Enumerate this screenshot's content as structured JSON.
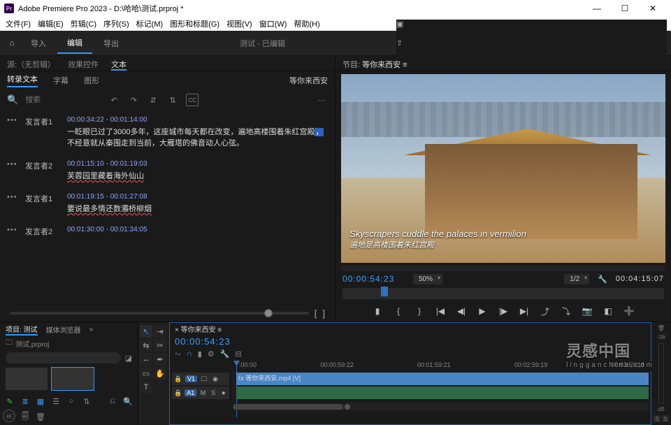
{
  "title": "Adobe Premiere Pro 2023 - D:\\哈哈\\测试.prproj *",
  "menu": [
    "文件(F)",
    "编辑(E)",
    "剪辑(C)",
    "序列(S)",
    "标记(M)",
    "图形和标题(G)",
    "视图(V)",
    "窗口(W)",
    "帮助(H)"
  ],
  "workspace": {
    "tabs": [
      "导入",
      "编辑",
      "导出"
    ],
    "active": "编辑",
    "status": "测试 - 已编辑"
  },
  "source_panel": {
    "tabs": [
      "源:（无剪辑）",
      "效果控件",
      "文本"
    ],
    "active": "文本",
    "sub_tabs": [
      "转录文本",
      "字幕",
      "图形"
    ],
    "sub_active": "转录文本",
    "context_label": "等你来西安",
    "search_placeholder": "搜索",
    "rows": [
      {
        "speaker": "发言者1",
        "tc": "00:00:34:22 - 00:01:14:00",
        "text_pre": "一眨眼已过了3000多年，这座城市每天都在改变，遍地高楼围着朱红宫殿",
        "hl": "，",
        "text_post": "不经意就从秦围走到当前，大雁塔的佛音动人心弦。"
      },
      {
        "speaker": "发言者2",
        "tc": "00:01:15:10 - 00:01:19:03",
        "underlined": "芙蓉园里藏着海外仙山"
      },
      {
        "speaker": "发言者1",
        "tc": "00:01:19:15 - 00:01:27:08",
        "underlined": "要说最多情还数灞桥柳烟"
      },
      {
        "speaker": "发言者2",
        "tc": "00:01:30:00 - 00:01:34:05"
      }
    ]
  },
  "program": {
    "title_prefix": "节目:",
    "title": "等你来西安",
    "subtitle_en": "Skyscrapers cuddle the palaces in vermilion",
    "subtitle_zh": "遍地是高楼围着朱红宫殿",
    "tc": "00:00:54:23",
    "zoom": "50%",
    "res": "1/2",
    "dur": "00:04:15:07"
  },
  "project": {
    "tabs": [
      "项目: 测试",
      "媒体浏览器"
    ],
    "active": "项目: 测试",
    "path": "测试.prproj"
  },
  "timeline": {
    "seq_name": "等你来西安",
    "tc": "00:00:54:23",
    "ruler": [
      ":00:00",
      "00:00:59:22",
      "00:01:59:21",
      "00:02:59:19",
      "00:03:59:18"
    ],
    "v1": "V1",
    "a1": "A1",
    "clip_v": "等你来西安.mp4 [V]",
    "meter_label": "-36",
    "meter_db": "dB",
    "solo": "S"
  },
  "watermark": {
    "main": "灵感中国",
    "sub": "lingganchina.com"
  }
}
